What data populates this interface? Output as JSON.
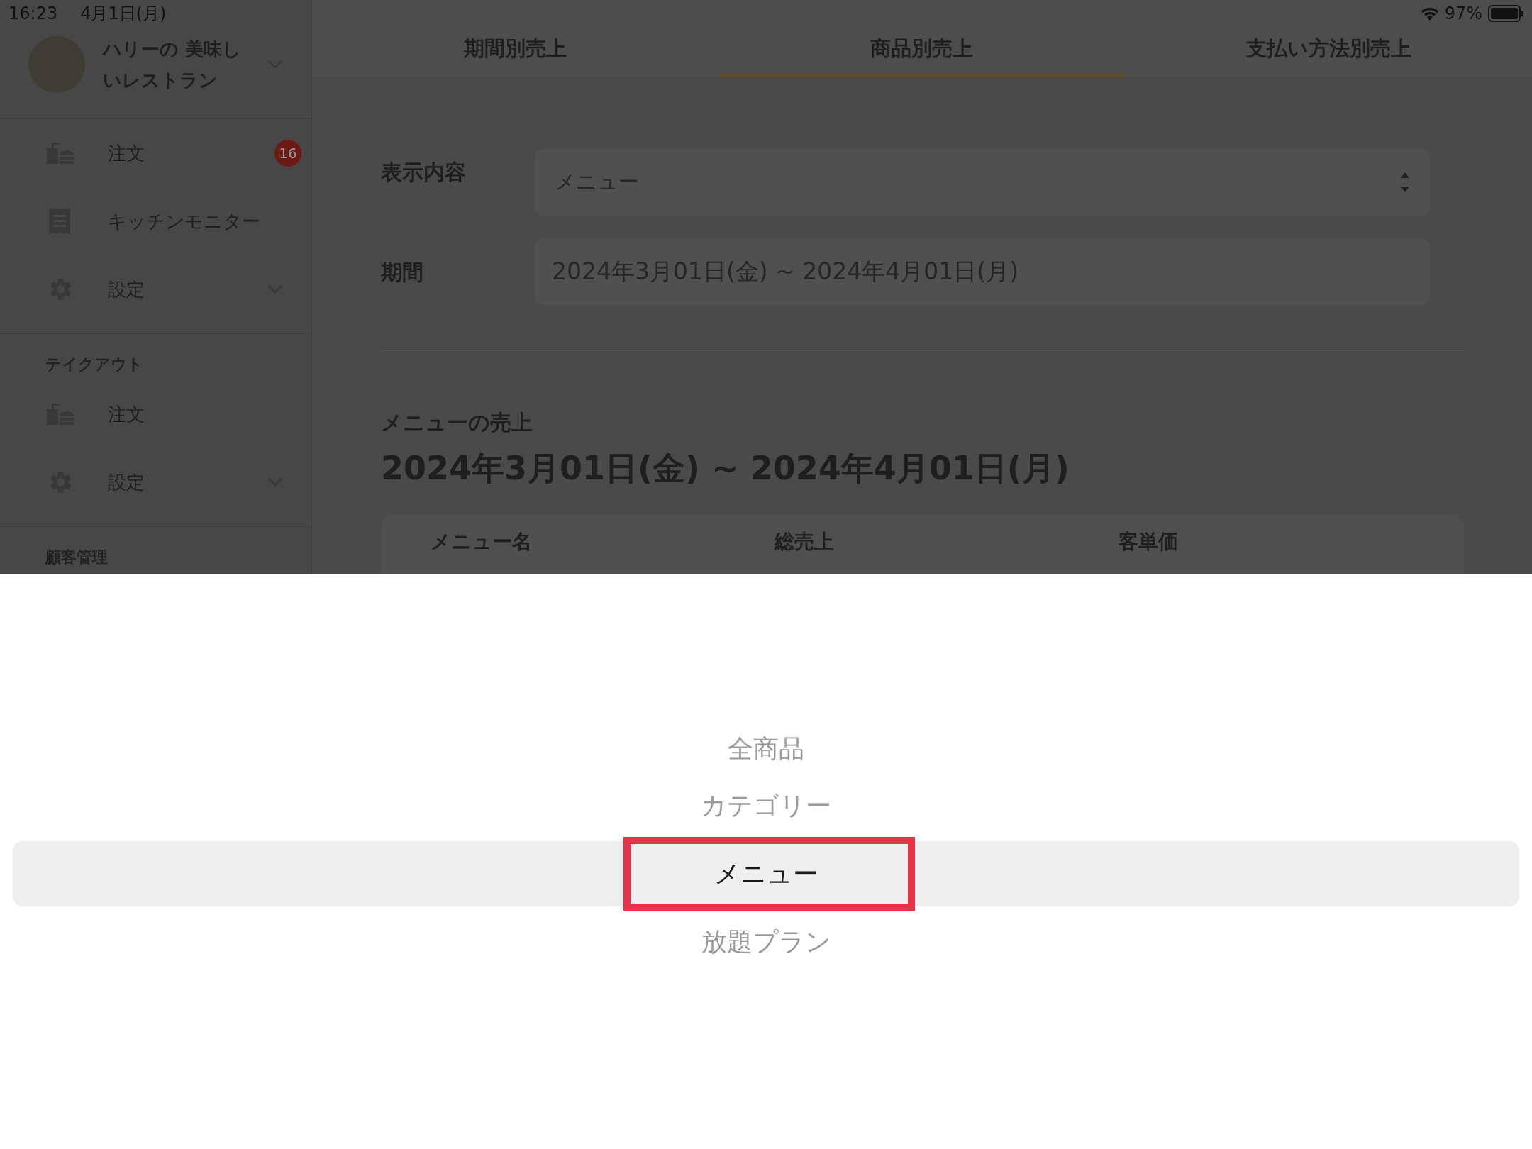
{
  "status_bar": {
    "time": "16:23",
    "date": "4月1日(月)",
    "battery": "97%"
  },
  "sidebar": {
    "account": {
      "name": "ハリーの 美味しいレストラン"
    },
    "sections": [
      {
        "items": [
          {
            "kind": "orders",
            "label": "注文",
            "badge": "16",
            "expandable": false
          },
          {
            "kind": "receipt",
            "label": "キッチンモニター",
            "expandable": false
          },
          {
            "kind": "settings",
            "label": "設定",
            "expandable": true
          }
        ]
      },
      {
        "title": "テイクアウト",
        "items": [
          {
            "kind": "orders",
            "label": "注文",
            "expandable": false
          },
          {
            "kind": "settings",
            "label": "設定",
            "expandable": true
          }
        ]
      },
      {
        "title": "顧客管理"
      }
    ]
  },
  "tabs": [
    {
      "label": "期間別売上",
      "selected": false
    },
    {
      "label": "商品別売上",
      "selected": true
    },
    {
      "label": "支払い方法別売上",
      "selected": false
    }
  ],
  "form": {
    "display": {
      "label": "表示内容",
      "value": "メニュー"
    },
    "period": {
      "label": "期間",
      "value": "2024年3月01日(金) ~ 2024年4月01日(月)"
    }
  },
  "report": {
    "title": "メニューの売上",
    "range": "2024年3月01日(金) ~ 2024年4月01日(月)",
    "columns": [
      "メニュー名",
      "総売上",
      "客単価"
    ]
  },
  "picker": {
    "options": [
      {
        "label": "全商品",
        "selected": false,
        "highlighted": false
      },
      {
        "label": "カテゴリー",
        "selected": false,
        "highlighted": false
      },
      {
        "label": "メニュー",
        "selected": true,
        "highlighted": true
      },
      {
        "label": "放題プラン",
        "selected": false,
        "highlighted": false
      }
    ]
  }
}
